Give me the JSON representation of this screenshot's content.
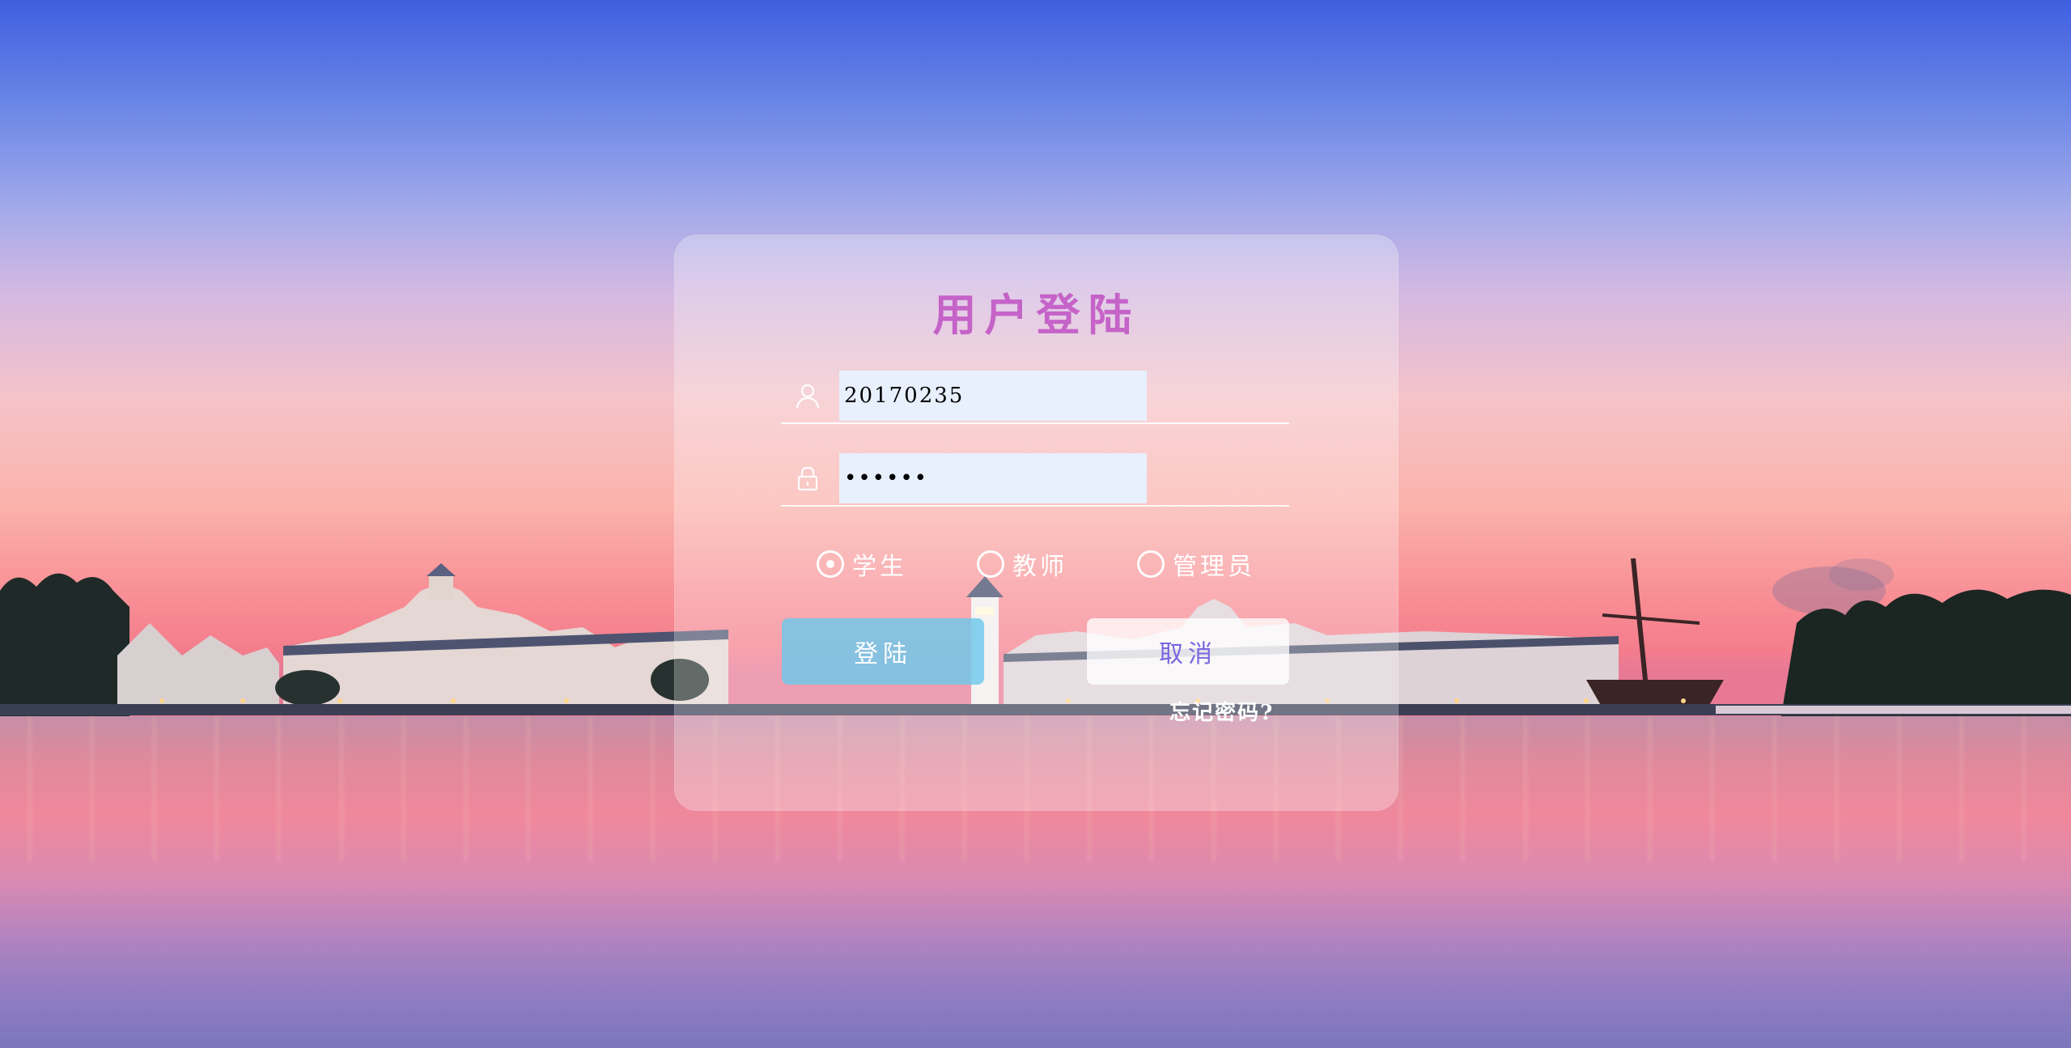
{
  "login_card": {
    "title": "用户登陆",
    "username": {
      "icon": "user-icon",
      "value": "20170235"
    },
    "password": {
      "icon": "lock-icon",
      "value": "••••••"
    },
    "roles": [
      {
        "label": "学生",
        "checked": true
      },
      {
        "label": "教师",
        "checked": false
      },
      {
        "label": "管理员",
        "checked": false
      }
    ],
    "login_button": "登陆",
    "cancel_button": "取消",
    "forgot_link": "忘记密码?"
  },
  "colors": {
    "title": "#c563c8",
    "login_button_bg": "#6ec8eb",
    "cancel_button_text": "#7a66e0",
    "input_bg": "#e8f0fe"
  }
}
